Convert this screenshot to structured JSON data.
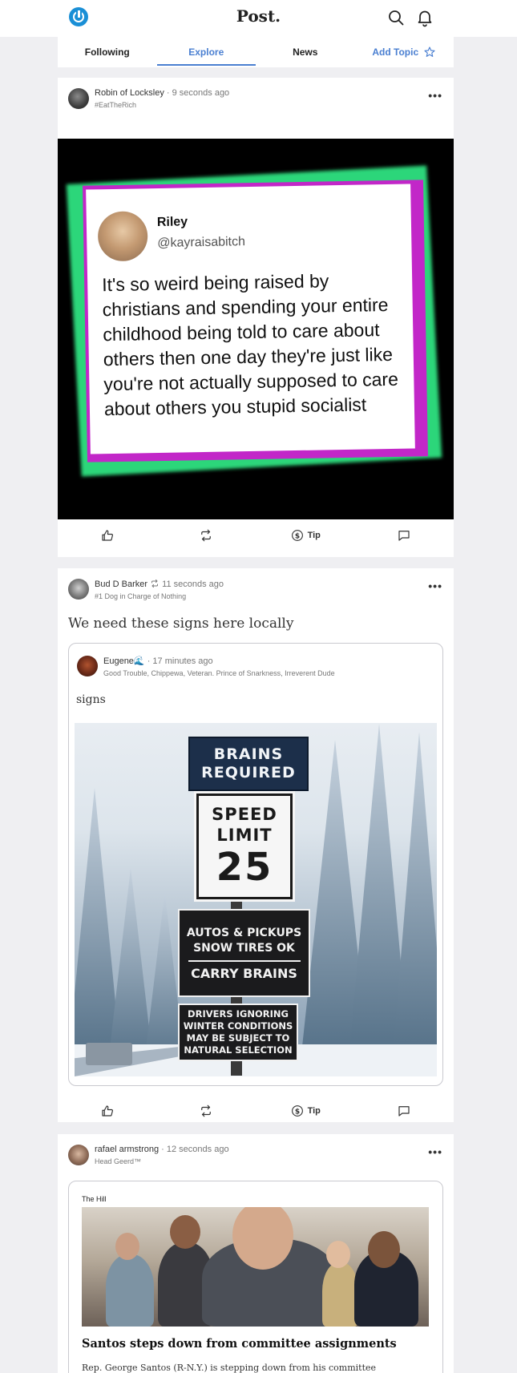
{
  "app": {
    "brand": "Post."
  },
  "tabs": [
    {
      "label": "Following"
    },
    {
      "label": "Explore",
      "active": true
    },
    {
      "label": "News"
    },
    {
      "label": "Add Topic"
    }
  ],
  "colors": {
    "accent": "#4a7fd1",
    "logo": "#1a8fd6"
  },
  "posts": [
    {
      "author": "Robin of Locksley",
      "time": "9 seconds ago",
      "subtitle": "#EatTheRich",
      "image": {
        "tweet_name": "Riley",
        "tweet_handle": "@kayraisabitch",
        "tweet_text": "It's so weird being raised by christians and spending your entire childhood being told to care about others then one day they're just like you're not actually supposed to care about others you stupid socialist"
      },
      "actions": {
        "tip": "Tip"
      }
    },
    {
      "author": "Bud D Barker",
      "time": "11 seconds ago",
      "subtitle": "#1 Dog in Charge of Nothing",
      "text": "We need these signs here locally",
      "quote": {
        "author": "Eugene🌊",
        "time": "17 minutes ago",
        "subtitle": "Good Trouble, Chippewa, Veteran. Prince of Snarkness, Irreverent Dude",
        "text": "signs",
        "image": {
          "sign1": "BRAINS REQUIRED",
          "sign2_label1": "SPEED",
          "sign2_label2": "LIMIT",
          "sign2_number": "25",
          "sign3_line1": "AUTOS & PICKUPS",
          "sign3_line2": "SNOW TIRES OK",
          "sign3_line3": "CARRY BRAINS",
          "sign4": "DRIVERS IGNORING WINTER CONDITIONS MAY BE SUBJECT TO NATURAL SELECTION"
        }
      },
      "actions": {
        "tip": "Tip"
      }
    },
    {
      "author": "rafael armstrong",
      "time": "12 seconds ago",
      "subtitle": "Head Geerd™",
      "link": {
        "source": "The Hill",
        "headline": "Santos steps down from committee assignments",
        "excerpt": "Rep. George Santos (R-N.Y.) is stepping down from his committee"
      }
    }
  ],
  "icons": [
    "logo-icon",
    "search-icon",
    "bell-icon",
    "star-icon",
    "like-icon",
    "repost-icon",
    "tip-icon",
    "comment-icon",
    "more-icon"
  ]
}
